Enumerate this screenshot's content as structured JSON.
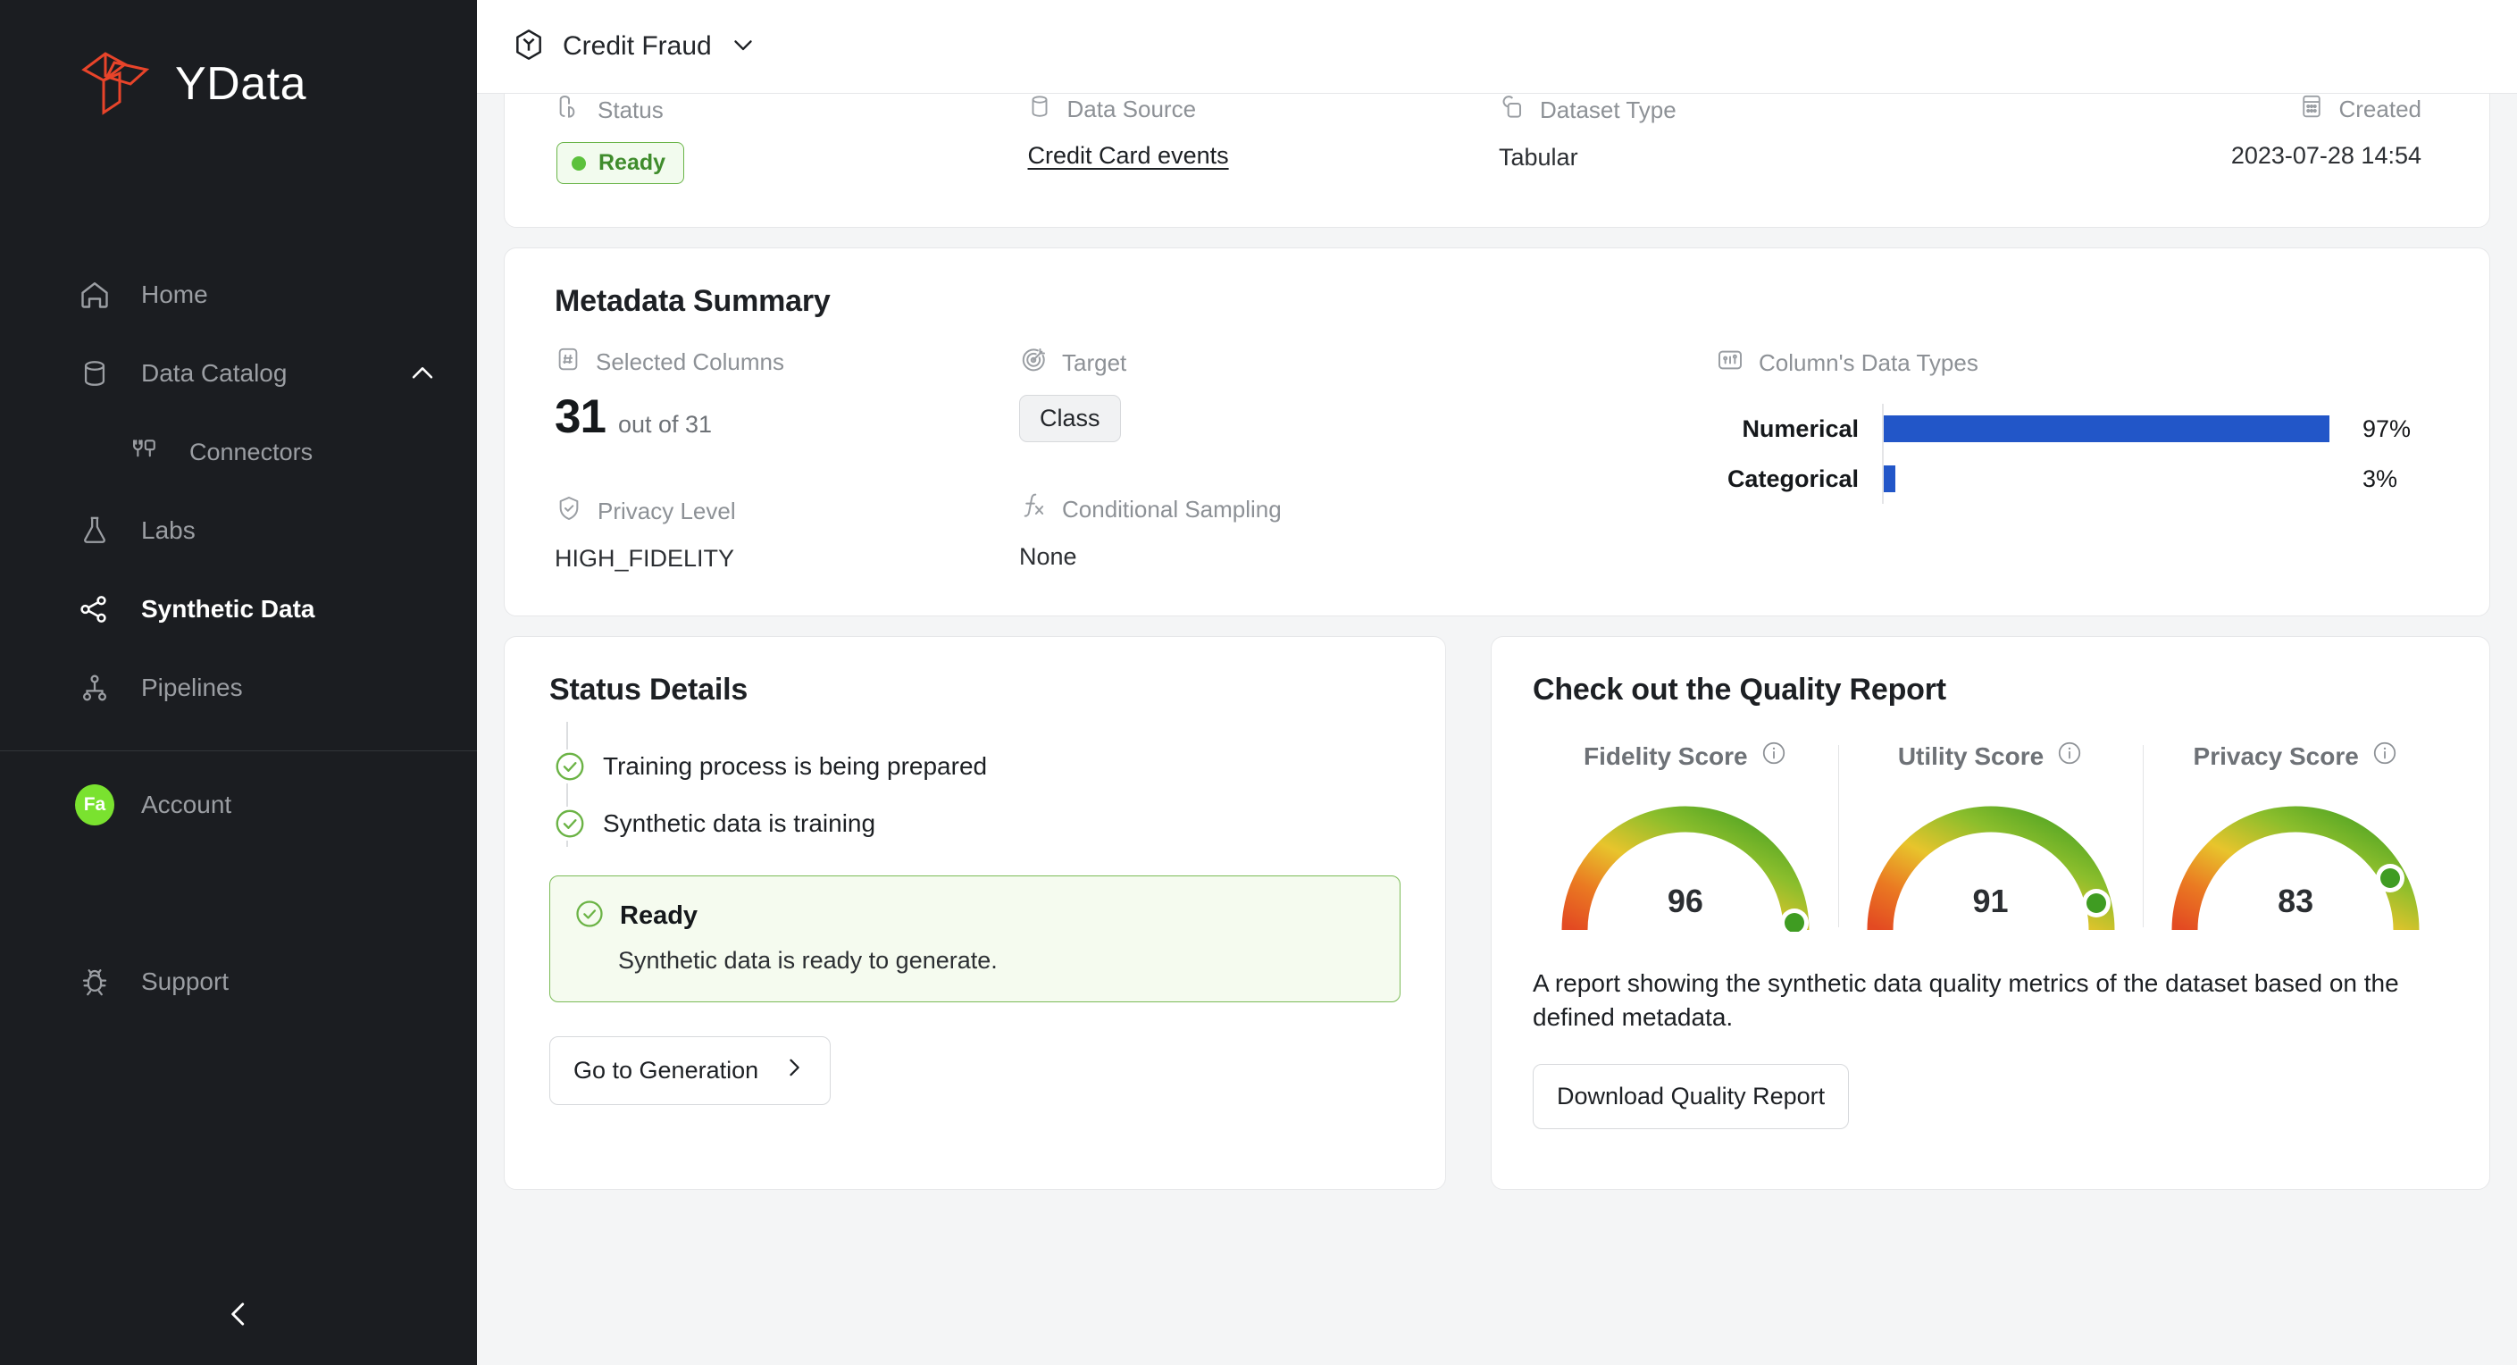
{
  "sidebar": {
    "brand": "YData",
    "items": [
      {
        "label": "Home",
        "icon": "home-icon"
      },
      {
        "label": "Data Catalog",
        "icon": "database-icon",
        "expand_icon": "chevron-up-icon"
      },
      {
        "label": "Connectors",
        "icon": "plug-icon"
      },
      {
        "label": "Labs",
        "icon": "flask-icon"
      },
      {
        "label": "Synthetic Data",
        "icon": "share-nodes-icon"
      },
      {
        "label": "Pipelines",
        "icon": "pipeline-icon"
      },
      {
        "label": "Account",
        "icon": "avatar",
        "avatar_initials": "Fa"
      },
      {
        "label": "Support",
        "icon": "bug-icon"
      }
    ],
    "collapse_icon": "chevron-left-icon",
    "active_item": "Synthetic Data",
    "avatar_color": "#7ae22f"
  },
  "topbar": {
    "title": "Credit Fraud",
    "project_icon": "cube-icon",
    "dropdown_icon": "chevron-down-icon"
  },
  "info_card": {
    "fields": [
      {
        "label": "Status",
        "icon": "status-icon",
        "value": "Ready",
        "type": "badge"
      },
      {
        "label": "Data Source",
        "icon": "database-icon",
        "value": "Credit Card events",
        "type": "link"
      },
      {
        "label": "Dataset Type",
        "icon": "dataset-type-icon",
        "value": "Tabular",
        "type": "text"
      },
      {
        "label": "Created",
        "icon": "calendar-icon",
        "value": "2023-07-28 14:54",
        "type": "text"
      }
    ]
  },
  "metadata": {
    "title": "Metadata Summary",
    "selected_columns": {
      "label": "Selected Columns",
      "icon": "hash-icon",
      "count": "31",
      "suffix": "out of 31"
    },
    "target": {
      "label": "Target",
      "icon": "target-icon",
      "value": "Class"
    },
    "privacy_level": {
      "label": "Privacy Level",
      "icon": "shield-check-icon",
      "value": "HIGH_FIDELITY"
    },
    "conditional_sampling": {
      "label": "Conditional Sampling",
      "icon": "function-icon",
      "value": "None"
    },
    "data_types": {
      "label": "Column's Data Types",
      "icon": "bar-chart-icon"
    }
  },
  "chart_data": {
    "type": "bar",
    "title": "Column's Data Types",
    "orientation": "horizontal",
    "categories": [
      "Numerical",
      "Categorical"
    ],
    "values": [
      97,
      3
    ],
    "labels": [
      "97%",
      "3%"
    ],
    "xlabel": "",
    "ylabel": "",
    "xlim": [
      0,
      100
    ],
    "grid": false,
    "legend": false,
    "bar_color": "#2256c8"
  },
  "status_details": {
    "title": "Status Details",
    "steps": [
      {
        "text": "Training process is being prepared",
        "icon": "check-circle-icon"
      },
      {
        "text": "Synthetic data is training",
        "icon": "check-circle-icon"
      }
    ],
    "current": {
      "icon": "check-circle-icon",
      "title": "Ready",
      "description": "Synthetic data is ready to generate.",
      "border_color": "#7bbb57",
      "background_color": "#f5fbef"
    },
    "action_button": {
      "label": "Go to Generation",
      "icon": "chevron-right-icon"
    }
  },
  "quality_report": {
    "title": "Check out the Quality Report",
    "scores": [
      {
        "label": "Fidelity Score",
        "value": "96",
        "info_icon": "info-icon"
      },
      {
        "label": "Utility Score",
        "value": "91",
        "info_icon": "info-icon"
      },
      {
        "label": "Privacy Score",
        "value": "83",
        "info_icon": "info-icon"
      }
    ],
    "description": "A report showing the synthetic data quality metrics of the dataset based on the defined metadata.",
    "download_button": "Download Quality Report"
  }
}
